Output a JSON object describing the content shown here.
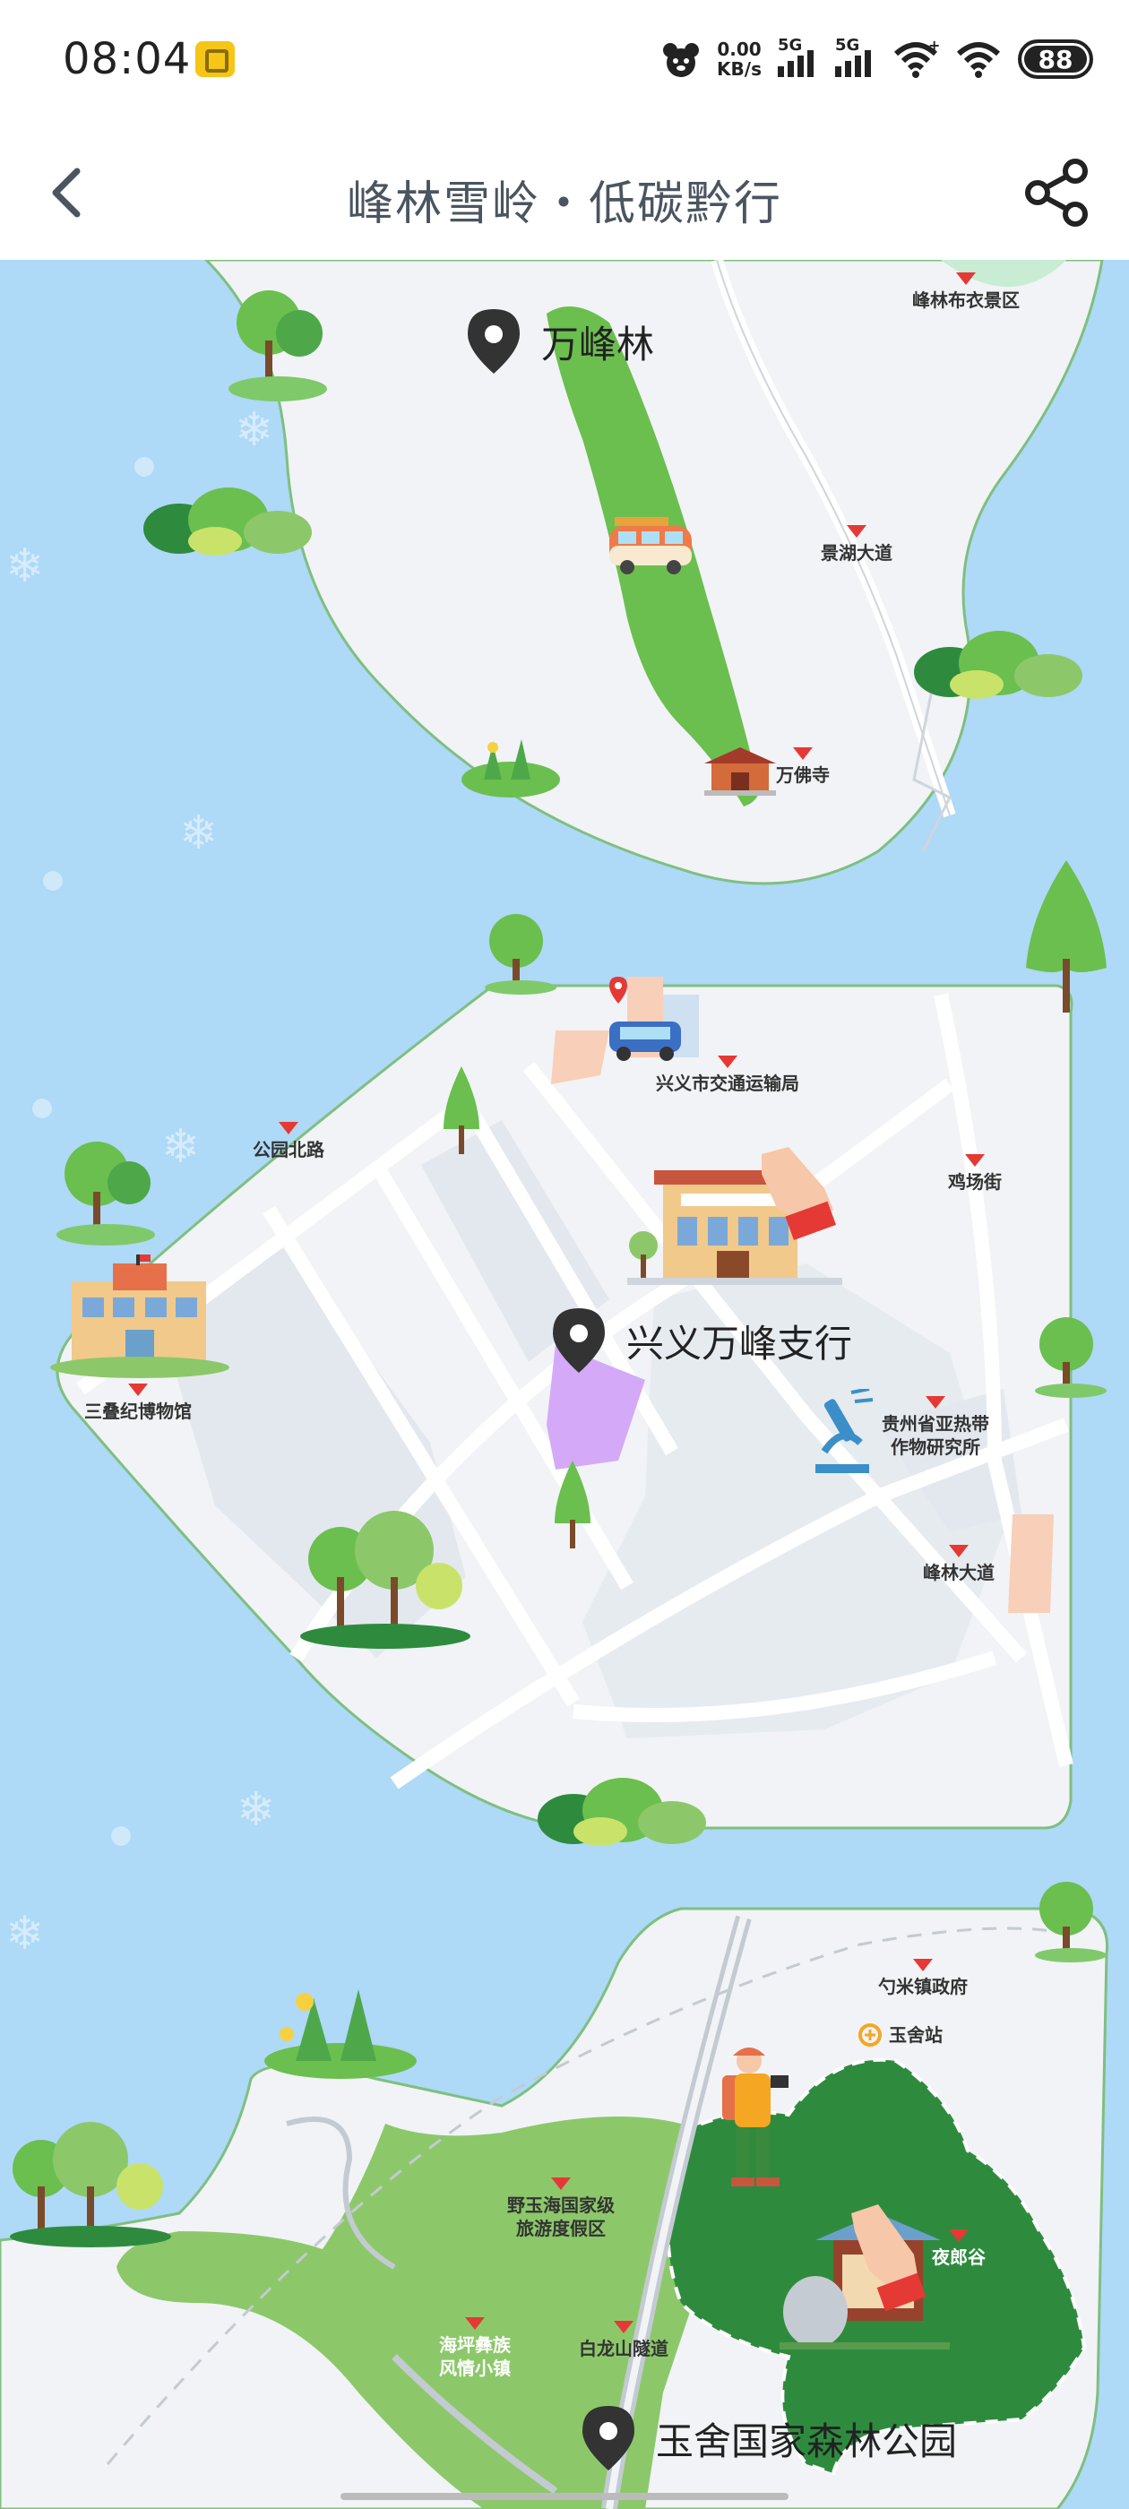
{
  "status_bar": {
    "time": "08:04",
    "net_speed_value": "0.00",
    "net_speed_unit": "KB/s",
    "signal_1_label": "5G",
    "signal_2_label": "5G",
    "battery": "88"
  },
  "header": {
    "title": "峰林雪岭・低碳黔行",
    "back_icon": "chevron-left-icon",
    "share_icon": "share-icon"
  },
  "map": {
    "pins": [
      {
        "label": "万峰林"
      },
      {
        "label": "兴义万峰支行"
      },
      {
        "label": "玉舍国家森林公园"
      }
    ],
    "pois": [
      {
        "label": "峰林布衣景区"
      },
      {
        "label": "景湖大道"
      },
      {
        "label": "万佛寺"
      },
      {
        "label": "兴义市交通运输局"
      },
      {
        "label": "公园北路"
      },
      {
        "label": "鸡场街"
      },
      {
        "label": "三叠纪博物馆"
      },
      {
        "label": "贵州省亚热带\n作物研究所"
      },
      {
        "label": "峰林大道"
      },
      {
        "label": "勺米镇政府"
      },
      {
        "label": "玉舍站"
      },
      {
        "label": "野玉海国家级\n旅游度假区"
      },
      {
        "label": "夜郎谷"
      },
      {
        "label": "海坪彝族\n风情小镇"
      },
      {
        "label": "白龙山隧道"
      }
    ],
    "colors": {
      "water": "#aed9f7",
      "land": "#f1f3f6",
      "park_green": "#6bbf4e",
      "forest_dark": "#2e8b3e",
      "road": "#ffffff",
      "poi_arrow": "#e53935"
    }
  }
}
